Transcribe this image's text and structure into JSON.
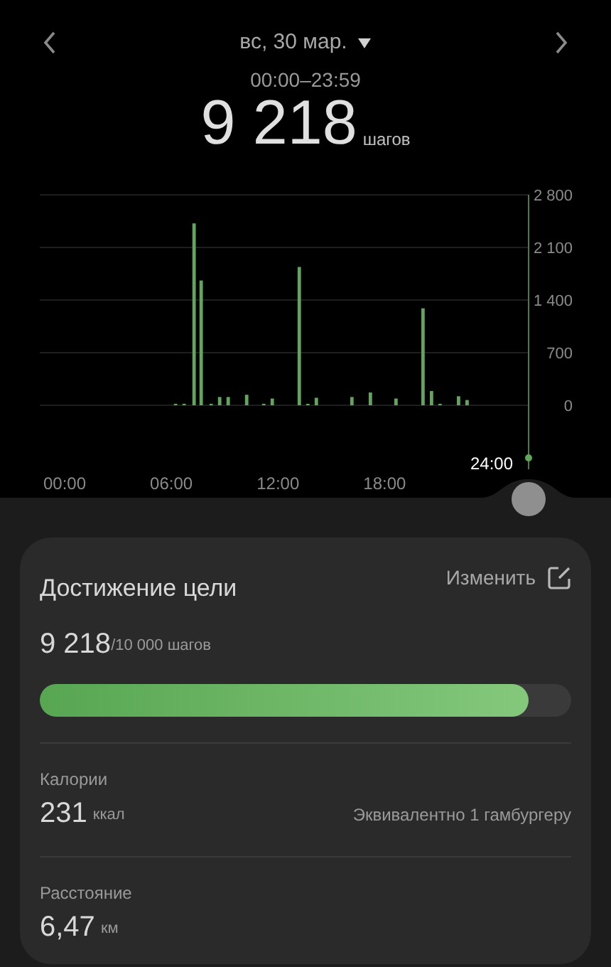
{
  "header": {
    "date": "вс, 30 мар.",
    "time_range": "00:00–23:59",
    "steps": "9 218",
    "unit": "шагов"
  },
  "chart": {
    "cursor_label": "24:00",
    "chart_data": {
      "type": "bar",
      "grid": true,
      "xlim": [
        -1.4,
        26.1
      ],
      "ylim": [
        0,
        2800
      ],
      "x": [
        6.24,
        6.72,
        7.28,
        7.68,
        8.24,
        8.72,
        9.2,
        10.24,
        11.2,
        11.68,
        13.2,
        13.68,
        14.16,
        16.16,
        17.2,
        18.64,
        20.16,
        20.64,
        21.12,
        22.16,
        22.64
      ],
      "series": [
        {
          "color": "#5fa85a",
          "values": [
            20,
            20,
            2420,
            1660,
            20,
            110,
            110,
            140,
            20,
            90,
            1840,
            20,
            100,
            110,
            170,
            90,
            1290,
            190,
            20,
            120,
            70
          ]
        }
      ],
      "xticks": [
        {
          "value": 0,
          "label": "00:00"
        },
        {
          "value": 6,
          "label": "06:00"
        },
        {
          "value": 12,
          "label": "12:00"
        },
        {
          "value": 18,
          "label": "18:00"
        }
      ],
      "yticks": [
        {
          "value": 0,
          "label": "0"
        },
        {
          "value": 700,
          "label": "700"
        },
        {
          "value": 1400,
          "label": "1 400"
        },
        {
          "value": 2100,
          "label": "2 100"
        },
        {
          "value": 2800,
          "label": "2 800"
        }
      ]
    }
  },
  "goal_card": {
    "title": "Достижение цели",
    "edit_label": "Изменить",
    "steps": "9 218",
    "goal": "/10 000 шагов",
    "level": 0.92
  },
  "stats": [
    {
      "label": "Калории",
      "value": "231",
      "unit": "ккал",
      "note": "Эквивалентно 1 гамбургеру"
    },
    {
      "label": "Расстояние",
      "value": "6,47",
      "unit": "км"
    }
  ]
}
